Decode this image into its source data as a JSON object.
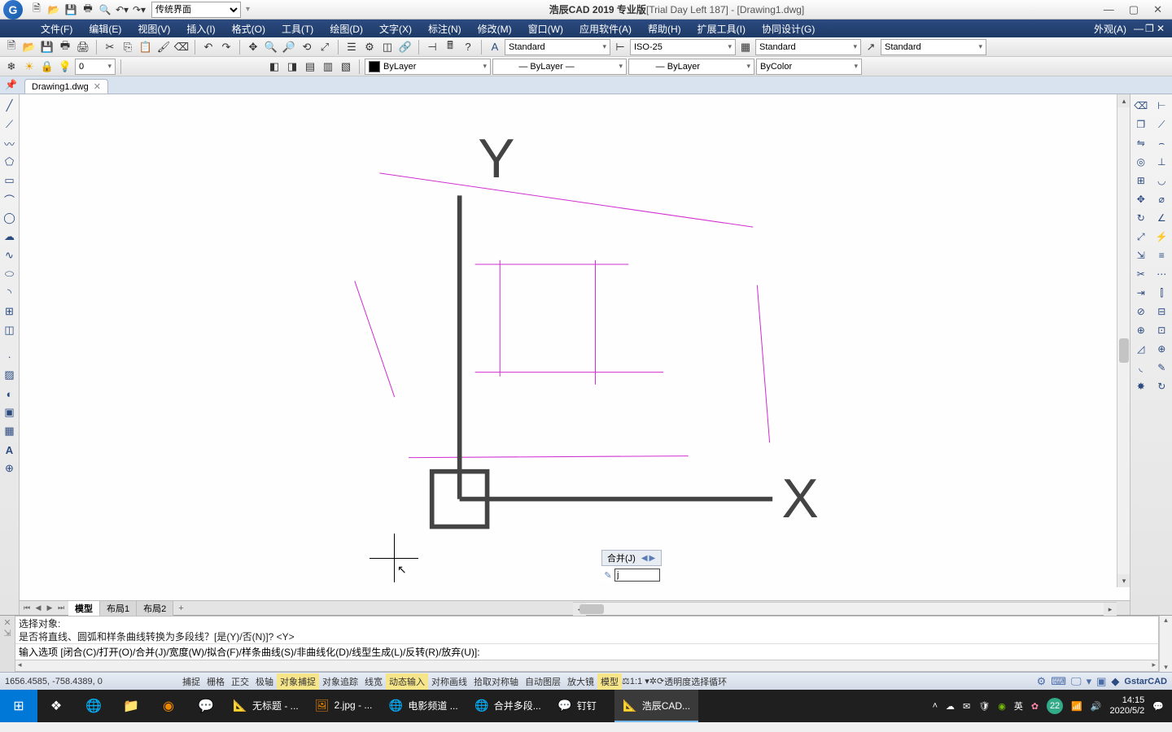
{
  "app": {
    "title_main": "浩辰CAD 2019 专业版",
    "title_trial": "[Trial Day Left 187] - [Drawing1.dwg]",
    "workspace_select": "传统界面"
  },
  "menus": [
    "文件(F)",
    "编辑(E)",
    "视图(V)",
    "插入(I)",
    "格式(O)",
    "工具(T)",
    "绘图(D)",
    "文字(X)",
    "标注(N)",
    "修改(M)",
    "窗口(W)",
    "应用软件(A)",
    "帮助(H)",
    "扩展工具(I)",
    "协同设计(G)"
  ],
  "menu_right": "外观(A)",
  "styles": {
    "text_style": "Standard",
    "dim_style": "ISO-25",
    "table_style": "Standard",
    "mleader_style": "Standard"
  },
  "layer": {
    "name": "ByLayer",
    "linetype": "ByLayer",
    "lineweight": "ByLayer",
    "color": "ByColor"
  },
  "doc_tab": "Drawing1.dwg",
  "layout_tabs": {
    "active": "模型",
    "others": [
      "布局1",
      "布局2"
    ]
  },
  "float_cmd": {
    "label": "合并(J)",
    "input": "j"
  },
  "cmd_history": [
    "选择对象:",
    "是否将直线、圆弧和样条曲线转换为多段线？[是(Y)/否(N)]? <Y>"
  ],
  "cmd_prompt": "输入选项 [闭合(C)/打开(O)/合并(J)/宽度(W)/拟合(F)/样条曲线(S)/非曲线化(D)/线型生成(L)/反转(R)/放弃(U)]:",
  "status": {
    "coords": "1656.4585, -758.4389, 0",
    "toggles": [
      {
        "label": "捕捉",
        "on": false
      },
      {
        "label": "栅格",
        "on": false
      },
      {
        "label": "正交",
        "on": false
      },
      {
        "label": "极轴",
        "on": false
      },
      {
        "label": "对象捕捉",
        "on": true
      },
      {
        "label": "对象追踪",
        "on": false
      },
      {
        "label": "线宽",
        "on": false
      },
      {
        "label": "动态输入",
        "on": true
      },
      {
        "label": "对称画线",
        "on": false
      },
      {
        "label": "拾取对称轴",
        "on": false
      },
      {
        "label": "自动图层",
        "on": false
      },
      {
        "label": "放大镜",
        "on": false
      },
      {
        "label": "模型",
        "on": true
      }
    ],
    "scale": "1:1",
    "transparency": "透明度",
    "cycle": "选择循环",
    "brand": "GstarCAD"
  },
  "taskbar": {
    "tasks": [
      {
        "icon": "📐",
        "label": "无标题 - ...",
        "color": "#d33"
      },
      {
        "icon": "🖼",
        "label": "2.jpg - ...",
        "color": "#e80"
      },
      {
        "icon": "🌐",
        "label": "电影频道 ...",
        "color": "#3a8"
      },
      {
        "icon": "🌐",
        "label": "合并多段...",
        "color": "#3a8"
      },
      {
        "icon": "💬",
        "label": "钉钉",
        "color": "#18e"
      },
      {
        "icon": "📐",
        "label": "浩辰CAD...",
        "color": "#18e",
        "active": true
      }
    ],
    "tray": {
      "ime": "英",
      "count": "22",
      "time": "14:15",
      "date": "2020/5/2"
    }
  }
}
